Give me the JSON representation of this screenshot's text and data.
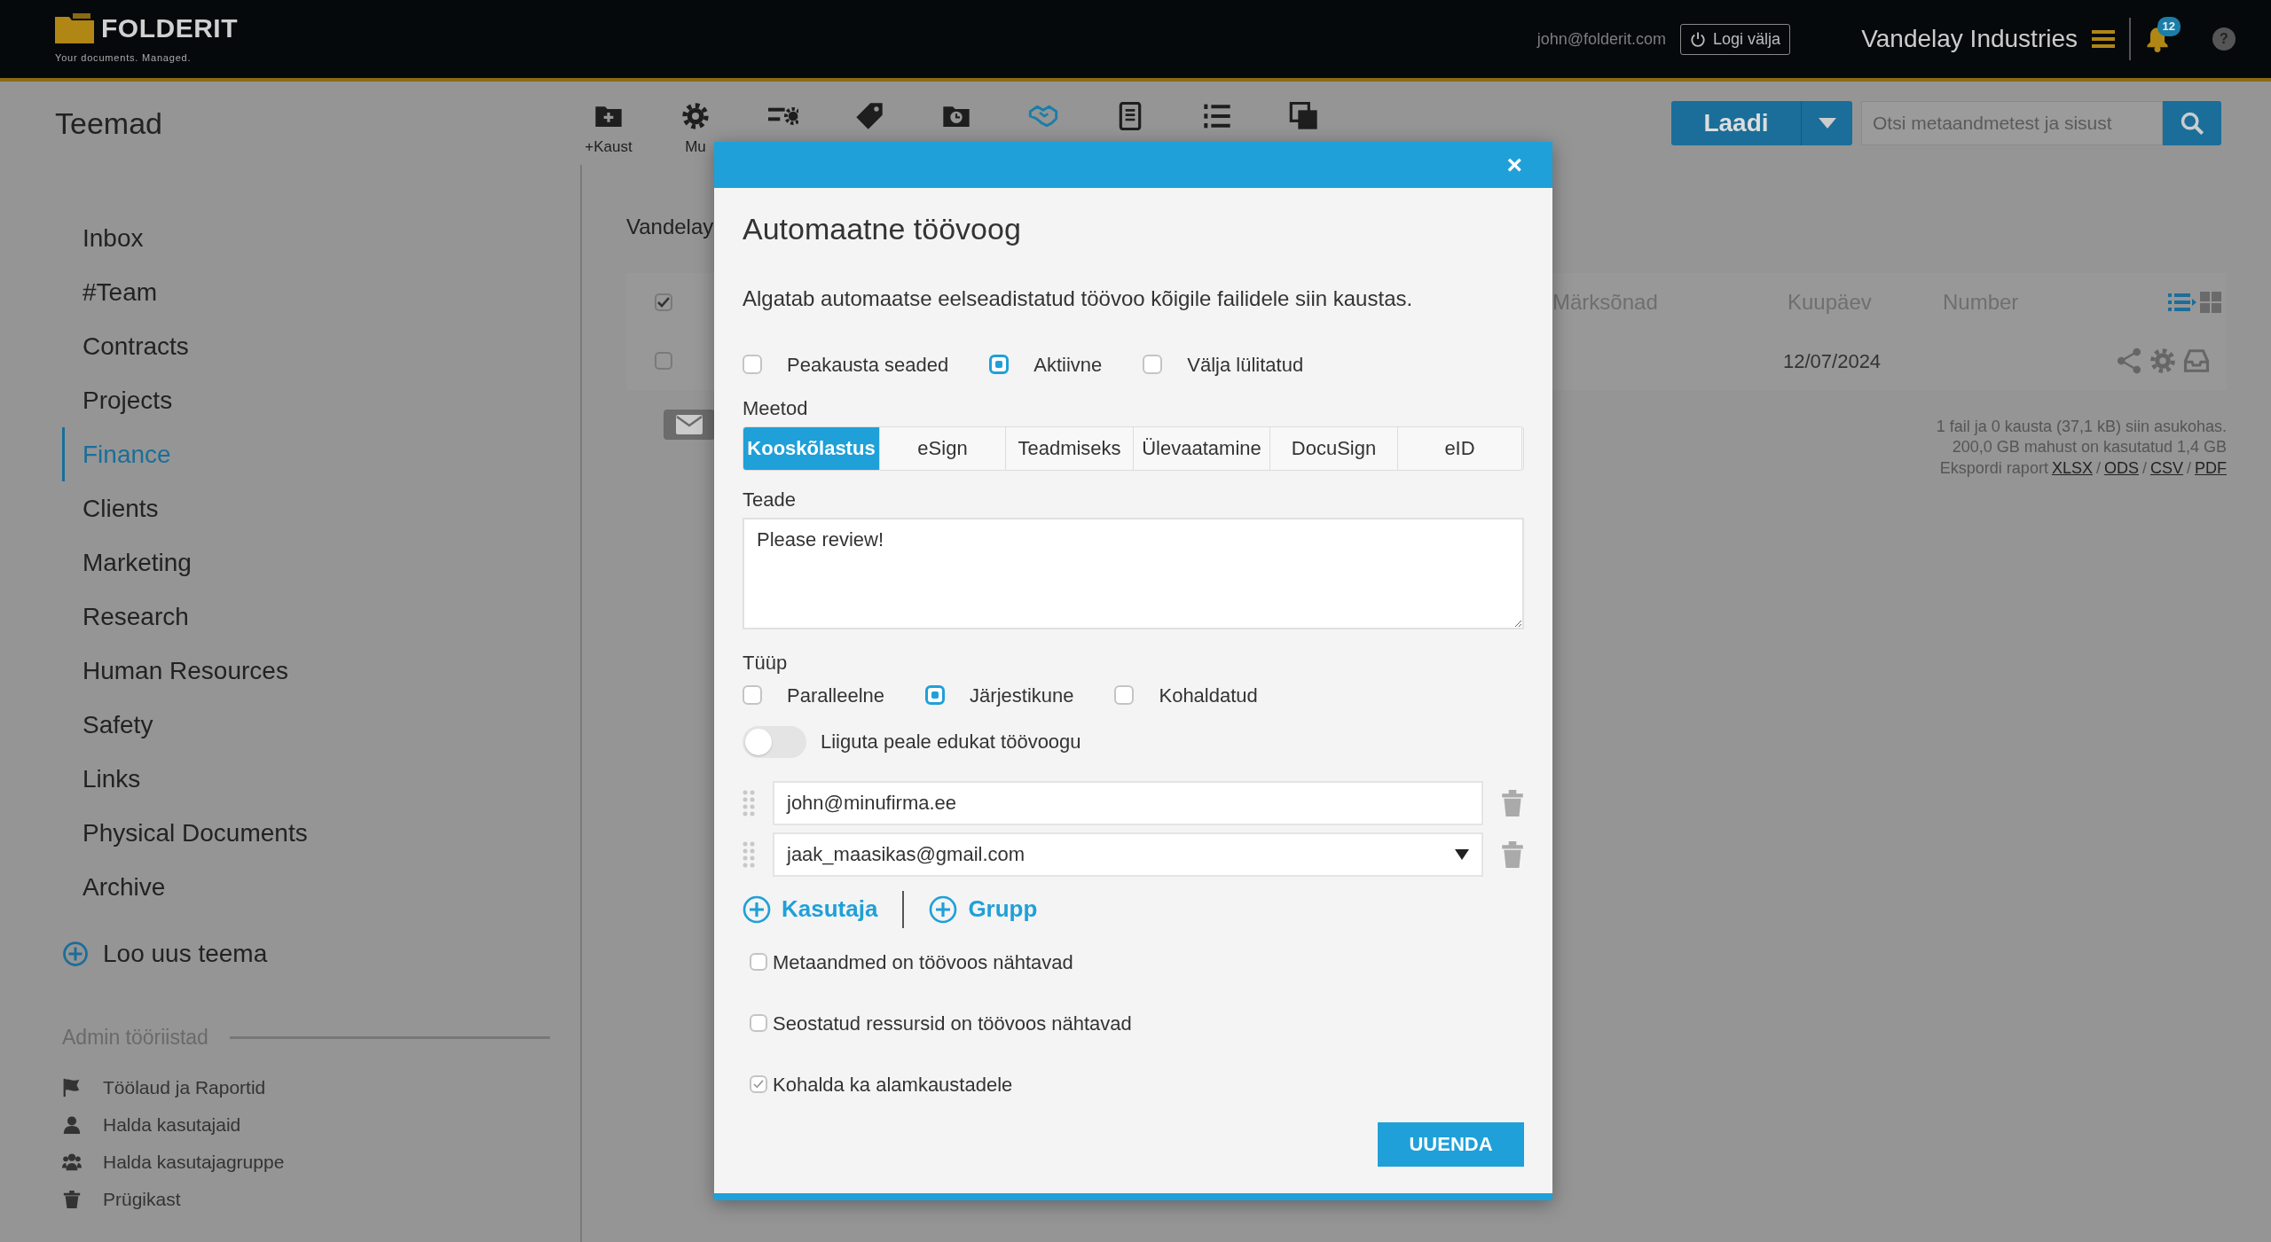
{
  "header": {
    "logo_text": "FOLDERIT",
    "tagline": "Your documents. Managed.",
    "user_email": "john@folderit.com",
    "logout": "Logi välja",
    "company": "Vandelay Industries",
    "notification_count": "12",
    "help": "?"
  },
  "page_title": "Teemad",
  "toolbar": [
    {
      "label": "+Kaust",
      "selected": false
    },
    {
      "label": "Mu",
      "selected": false
    },
    {
      "selected": false
    },
    {
      "selected": false
    },
    {
      "selected": false
    },
    {
      "selected": true
    },
    {
      "selected": false
    },
    {
      "selected": false
    },
    {
      "selected": false
    }
  ],
  "upload_button": "Laadi",
  "search": {
    "placeholder": "Otsi metaandmetest ja sisust"
  },
  "sidebar": {
    "items": [
      {
        "label": "Inbox",
        "selected": false
      },
      {
        "label": "#Team",
        "selected": false
      },
      {
        "label": "Contracts",
        "selected": false
      },
      {
        "label": "Projects",
        "selected": false
      },
      {
        "label": "Finance",
        "selected": true
      },
      {
        "label": "Clients",
        "selected": false
      },
      {
        "label": "Marketing",
        "selected": false
      },
      {
        "label": "Research",
        "selected": false
      },
      {
        "label": "Human Resources",
        "selected": false
      },
      {
        "label": "Safety",
        "selected": false
      },
      {
        "label": "Links",
        "selected": false
      },
      {
        "label": "Physical Documents",
        "selected": false
      },
      {
        "label": "Archive",
        "selected": false
      }
    ],
    "new_theme": "Loo uus teema",
    "admin_title": "Admin tööriistad",
    "admin_items": [
      {
        "label": "Töölaud ja Raportid",
        "kind": "flag"
      },
      {
        "label": "Halda kasutajaid",
        "kind": "user"
      },
      {
        "label": "Halda kasutajagruppe",
        "kind": "users"
      },
      {
        "label": "Prügikast",
        "kind": "trash"
      }
    ]
  },
  "content": {
    "breadcrumb": "Vandelay",
    "header_checked": true,
    "columns": [
      "Märksõnad",
      "Kuupäev",
      "Number"
    ],
    "rows": [
      {
        "checked": false,
        "date": "12/07/2024"
      }
    ],
    "stats": [
      "1 fail ja 0 kausta (37,1 kB) siin asukohas.",
      "200,0 GB mahust on kasutatud 1,4 GB"
    ],
    "export": {
      "label": "Ekspordi raport",
      "separator": "/",
      "formats": [
        "XLSX",
        "ODS",
        "CSV",
        "PDF"
      ]
    }
  },
  "modal": {
    "close": "×",
    "title": "Automaatne töövoog",
    "description": "Algatab automaatse eelseadistatud töövoo kõigile failidele siin kaustas.",
    "status_options": [
      {
        "label": "Peakausta seaded",
        "selected": false
      },
      {
        "label": "Aktiivne",
        "selected": true
      },
      {
        "label": "Välja lülitatud",
        "selected": false
      }
    ],
    "method_label": "Meetod",
    "methods": [
      {
        "label": "Kooskõlastus",
        "selected": true
      },
      {
        "label": "eSign",
        "selected": false
      },
      {
        "label": "Teadmiseks",
        "selected": false
      },
      {
        "label": "Ülevaatamine",
        "selected": false
      },
      {
        "label": "DocuSign",
        "selected": false
      },
      {
        "label": "eID",
        "selected": false
      }
    ],
    "message_label": "Teade",
    "message": "Please review!",
    "type_label": "Tüüp",
    "types": [
      {
        "label": "Paralleelne",
        "selected": false
      },
      {
        "label": "Järjestikune",
        "selected": true
      },
      {
        "label": "Kohaldatud",
        "selected": false
      }
    ],
    "move_toggle": {
      "label": "Liiguta peale edukat töövoogu",
      "on": false
    },
    "recipients": [
      {
        "value": "john@minufirma.ee",
        "kind": "text"
      },
      {
        "value": "jaak_maasikas@gmail.com",
        "kind": "select"
      }
    ],
    "add_user": "Kasutaja",
    "add_group": "Grupp",
    "options": [
      {
        "label": "Metaandmed on töövoos nähtavad",
        "checked": false
      },
      {
        "label": "Seostatud ressursid on töövoos nähtavad",
        "checked": false
      },
      {
        "label": "Kohalda ka alamkaustadele",
        "checked": true
      }
    ],
    "submit": "UUENDA"
  }
}
